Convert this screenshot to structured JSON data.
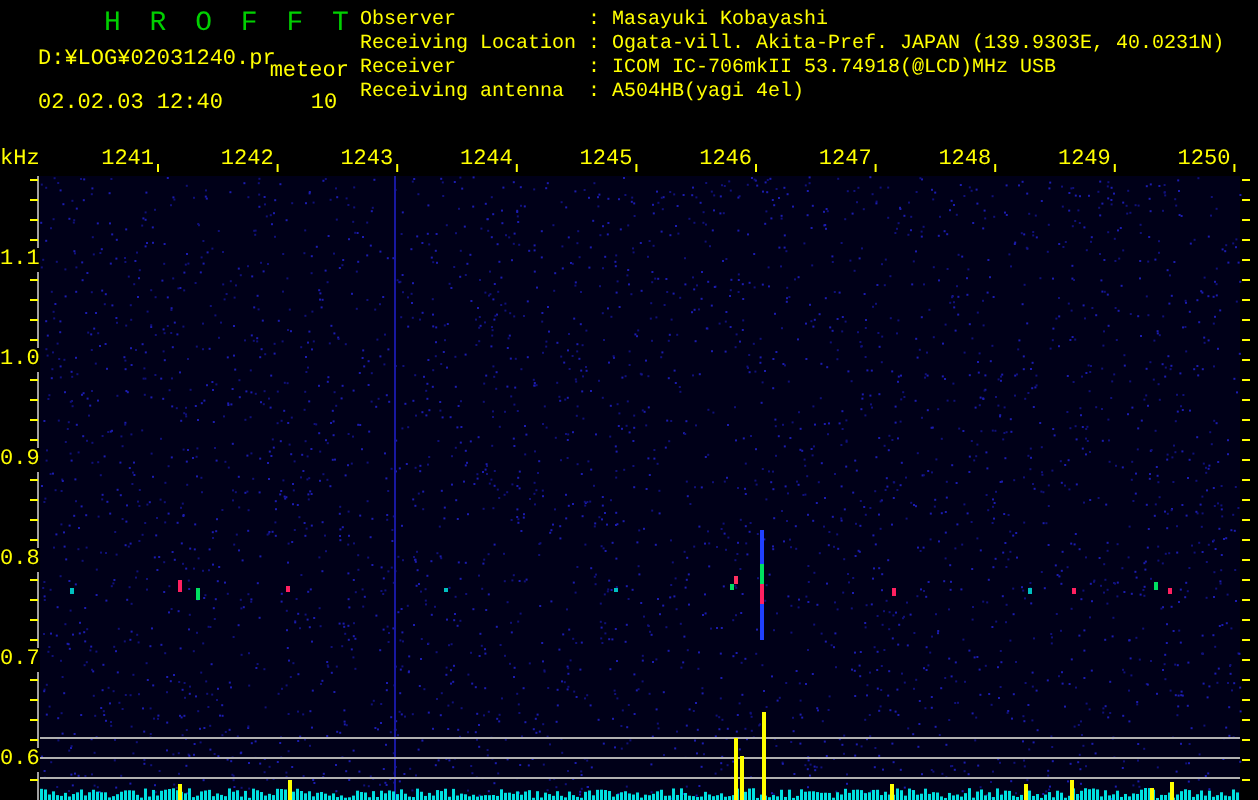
{
  "app_title": "H R O F F T",
  "file_path": "D:¥LOG¥02031240.pr",
  "mode": "meteor",
  "datetime": "02.02.03 12:40",
  "count": "10",
  "info": [
    {
      "label": "Observer",
      "separator": ":",
      "value": "Masayuki Kobayashi"
    },
    {
      "label": "Receiving Location",
      "separator": ":",
      "value": "Ogata-vill. Akita-Pref. JAPAN (139.9303E, 40.0231N)"
    },
    {
      "label": "Receiver",
      "separator": ":",
      "value": "ICOM IC-706mkII 53.74918(@LCD)MHz USB"
    },
    {
      "label": "Receiving antenna",
      "separator": ":",
      "value": "A504HB(yagi 4el)"
    }
  ],
  "spectrogram": {
    "unit": "kHz",
    "x_labels": [
      "1241",
      "1242",
      "1243",
      "1244",
      "1245",
      "1246",
      "1247",
      "1248",
      "1249",
      "1250"
    ],
    "y_labels": [
      "1.1",
      "1.0",
      "0.9",
      "0.8",
      "0.7",
      "0.6"
    ]
  }
}
